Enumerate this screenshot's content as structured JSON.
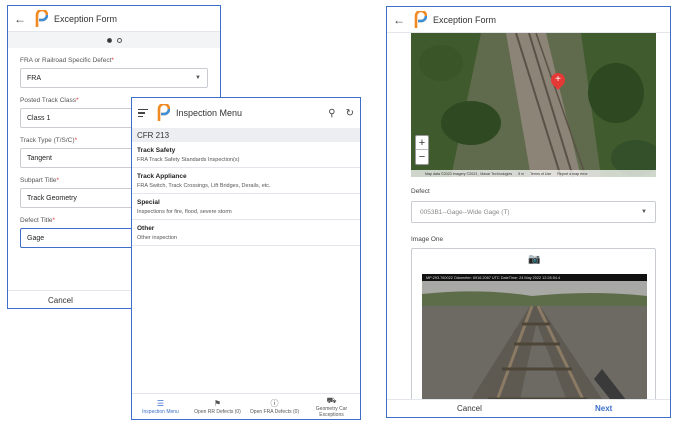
{
  "left_form": {
    "title": "Exception Form",
    "fields": [
      {
        "label": "FRA or Railroad Specific Defect",
        "value": "FRA",
        "dropdown": true
      },
      {
        "label": "Posted Track Class",
        "value": "Class 1",
        "dropdown": false
      },
      {
        "label": "Track Type (T/S/C)",
        "value": "Tangent",
        "dropdown": false
      },
      {
        "label": "Subpart Title",
        "value": "Track Geometry",
        "dropdown": false
      },
      {
        "label": "Defect Title",
        "value": "Gage",
        "dropdown": false
      }
    ],
    "required_mark": "*",
    "cancel_label": "Cancel"
  },
  "menu": {
    "title": "Inspection Menu",
    "section": "CFR 213",
    "items": [
      {
        "title": "Track Safety",
        "subtitle": "FRA Track Safety Standards Inspection(s)"
      },
      {
        "title": "Track Appliance",
        "subtitle": "FRA Switch, Track Crossings, Lift Bridges, Derails, etc."
      },
      {
        "title": "Special",
        "subtitle": "Inspections for fire, flood, severe storm"
      },
      {
        "title": "Other",
        "subtitle": "Other inspection"
      }
    ],
    "tabs": [
      {
        "label": "Inspection Menu",
        "icon": "list-icon"
      },
      {
        "label": "Open RR Defects (0)",
        "icon": "flag-icon"
      },
      {
        "label": "Open FRA Defects (0)",
        "icon": "alert-icon"
      },
      {
        "label": "Geometry Car Exceptions",
        "icon": "train-car-icon"
      }
    ]
  },
  "right_form": {
    "title": "Exception Form",
    "map_attribution": "Map data ©2023 Imagery ©2023 , Maxar Technologies",
    "map_scale": "5 m",
    "map_terms": "Terms of Use",
    "map_report": "Report a map error",
    "defect_label": "Defect",
    "defect_value": "0053B1--Gage--Wide Gage (T)",
    "image_label": "Image One",
    "photo_caption": "MP:293.760022 Odometer: 6916.2087 UTC DateTime: 24 May 2022 12:28:54.4",
    "cancel_label": "Cancel",
    "next_label": "Next"
  },
  "colors": {
    "accent": "#3d6fc9",
    "pin": "#e53935"
  }
}
